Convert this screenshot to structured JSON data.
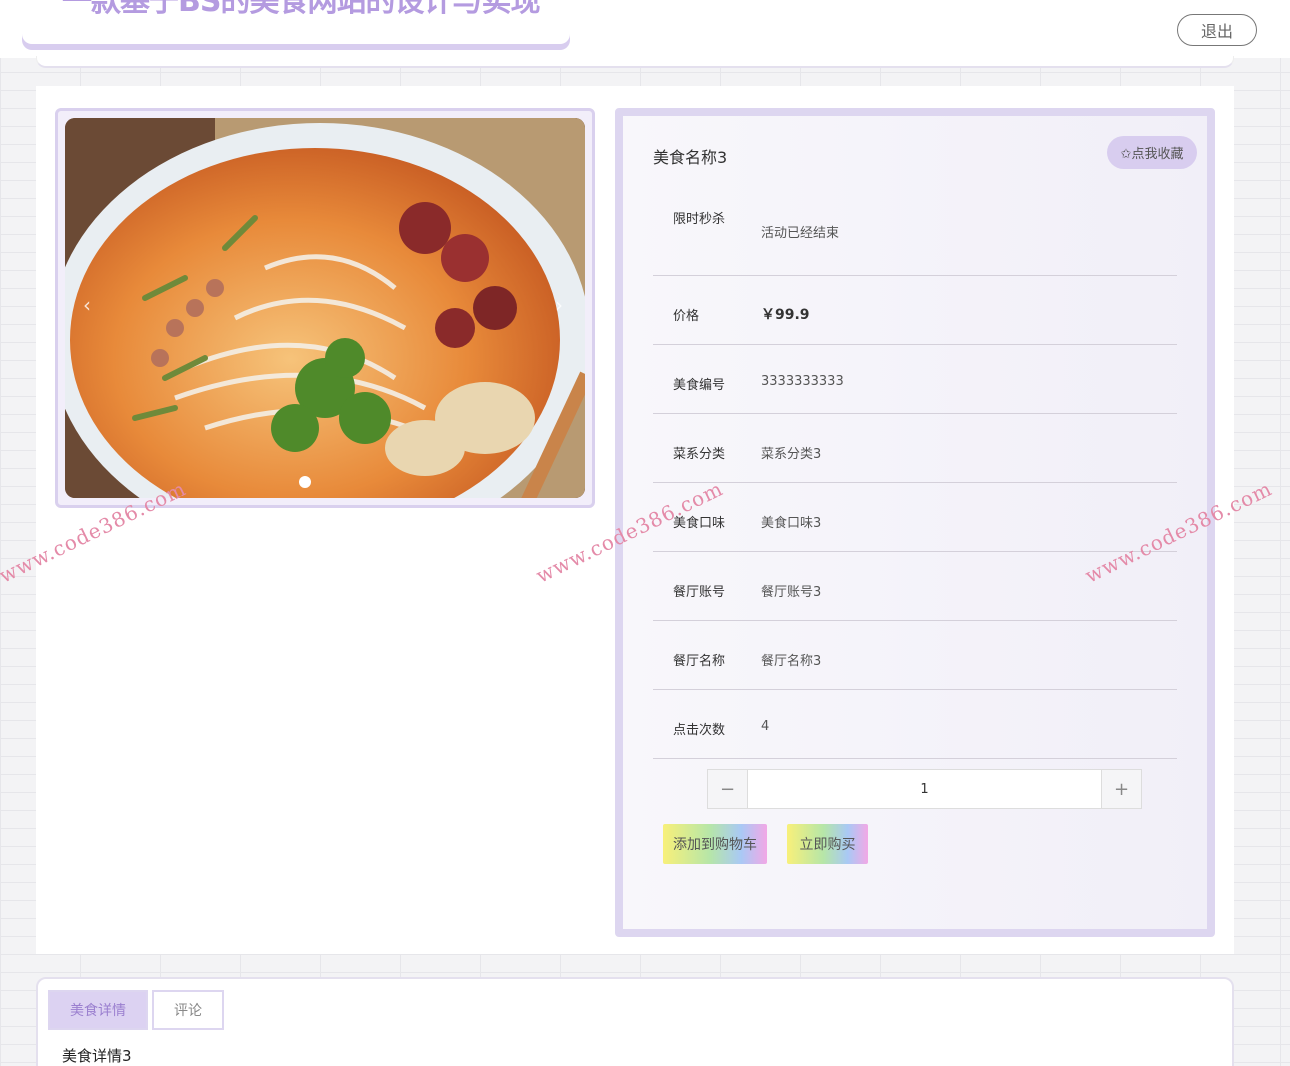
{
  "header": {
    "title": "一款基于BS的美食网站的设计与实现",
    "logout_label": "退出"
  },
  "gallery": {
    "prev_arrow": "‹",
    "next_arrow": "›"
  },
  "food": {
    "name": "美食名称3",
    "favorite_label": "✩点我收藏",
    "rows": [
      {
        "label": "限时秒杀",
        "value": "活动已经结束"
      },
      {
        "label": "价格",
        "value": "￥99.9"
      },
      {
        "label": "美食编号",
        "value": "3333333333"
      },
      {
        "label": "菜系分类",
        "value": "菜系分类3"
      },
      {
        "label": "美食口味",
        "value": "美食口味3"
      },
      {
        "label": "餐厅账号",
        "value": "餐厅账号3"
      },
      {
        "label": "餐厅名称",
        "value": "餐厅名称3"
      },
      {
        "label": "点击次数",
        "value": "4"
      }
    ],
    "quantity": "1",
    "minus_label": "−",
    "plus_label": "+",
    "add_cart_label": "添加到购物车",
    "buy_now_label": "立即购买"
  },
  "tabs": {
    "detail_label": "美食详情",
    "comment_label": "评论",
    "detail_text": "美食详情3"
  },
  "watermark": "www.code386.com",
  "colors": {
    "accent": "#d8cdef",
    "title": "#b49be0"
  }
}
